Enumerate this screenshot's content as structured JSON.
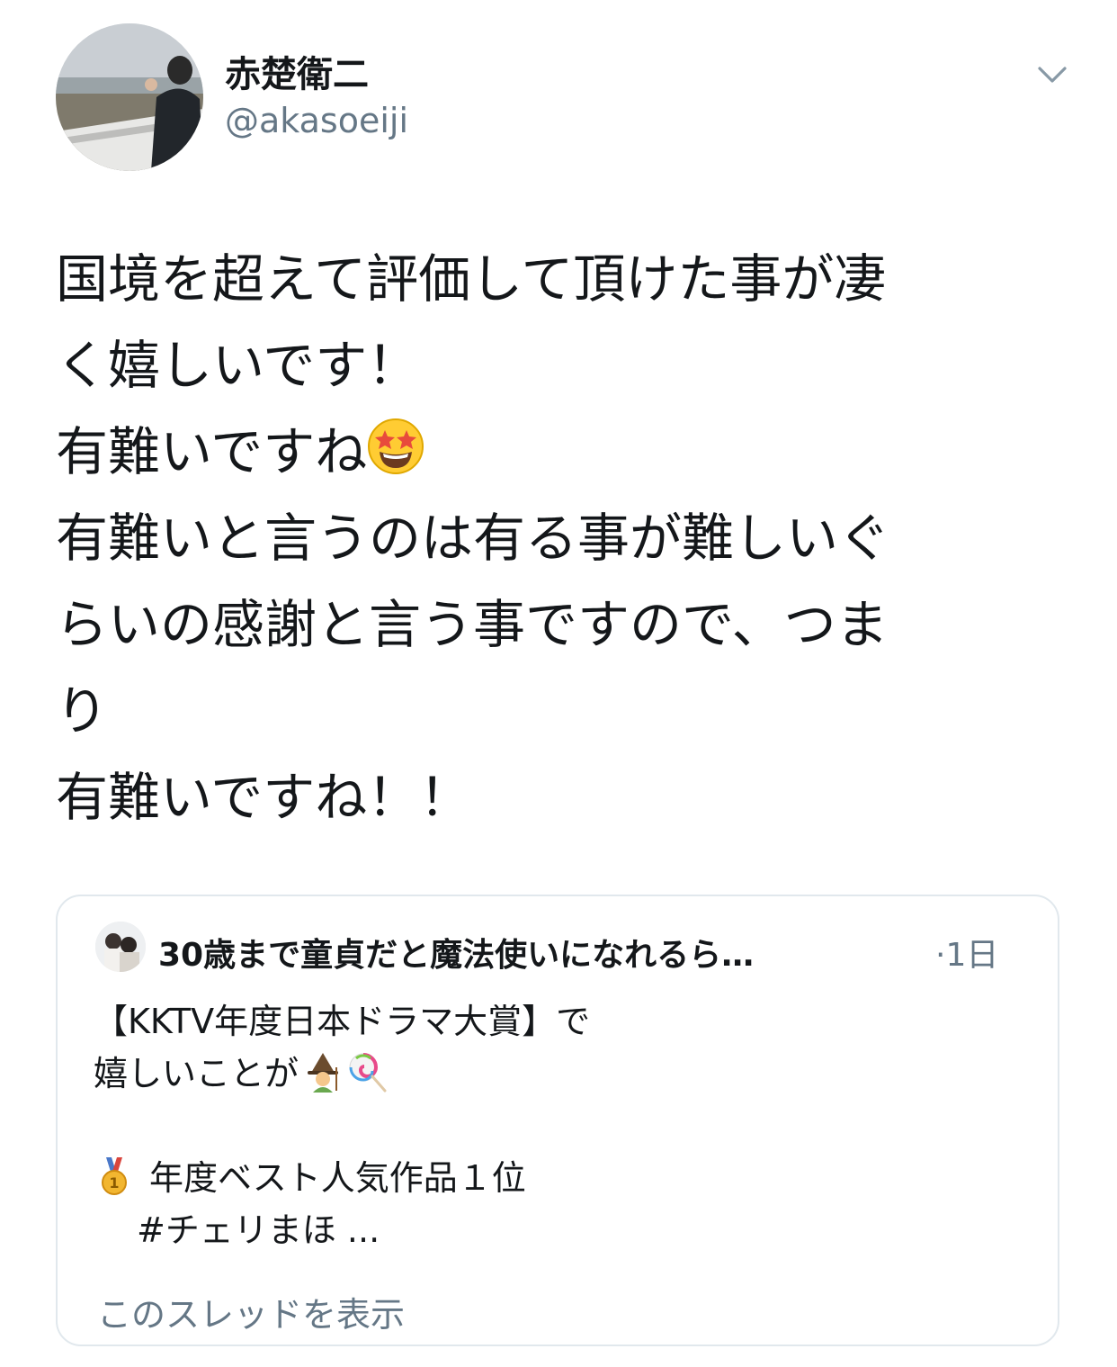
{
  "author": {
    "display_name": "赤楚衛二",
    "handle": "@akasoeiji",
    "avatar_icon": "profile-photo"
  },
  "menu_icon": "chevron-down-icon",
  "tweet": {
    "lines": [
      "国境を超えて評価して頂けた事が凄",
      "く嬉しいです！",
      "有難いですね",
      "有難いと言うのは有る事が難しいぐ",
      "らいの感謝と言う事ですので、つま",
      "り",
      "有難いですね！！"
    ],
    "emoji_after_line_3": "star-struck-emoji"
  },
  "quoted_tweet": {
    "account_name": "30歳まで童貞だと魔法使いになれるら…",
    "time": "·1日",
    "lines": [
      "【KKTV年度日本ドラマ大賞】で",
      "嬉しいことが",
      "",
      "年度ベスト人気作品１位",
      "#チェリまほ ..."
    ],
    "line_2_emojis": [
      "mage-emoji",
      "lollipop-emoji"
    ],
    "line_4_emoji": "first-place-medal-emoji",
    "show_thread_label": "このスレッドを表示"
  },
  "colors": {
    "primary_text": "#14171a",
    "secondary_text": "#657786",
    "card_border": "#e1e8ed"
  }
}
